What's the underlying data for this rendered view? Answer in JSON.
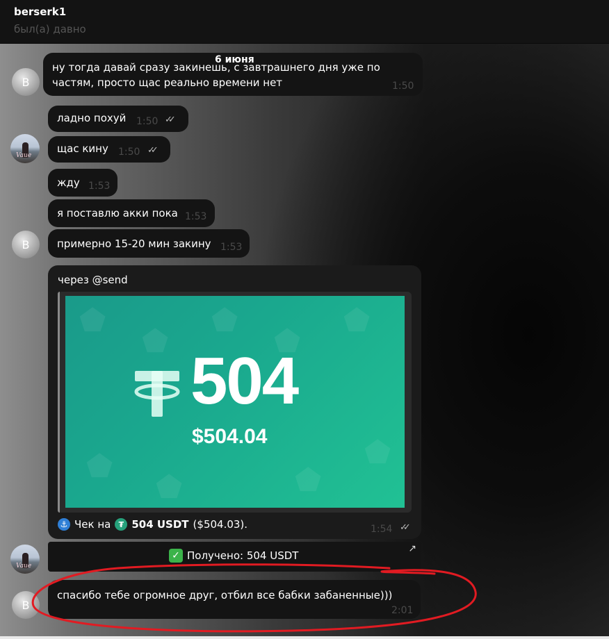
{
  "header": {
    "name": "berserk1",
    "status": "был(а) давно"
  },
  "date_label": "6 июня",
  "messages": [
    {
      "text": "ну тогда давай сразу закинешь, с завтрашнего дня уже по",
      "text2": "частям, просто щас реально времени нет",
      "time": "1:50"
    },
    {
      "text": "ладно похуй",
      "time": "1:50"
    },
    {
      "text": "щас кину",
      "time": "1:50"
    },
    {
      "text": "жду",
      "time": "1:53"
    },
    {
      "text": "я поставлю акки пока",
      "time": "1:53"
    },
    {
      "text": "примерно 15-20 мин закину",
      "time": "1:53"
    },
    {
      "text": "спасибо тебе огромное друг, отбил все бабки забаненные)))",
      "time": "2:01"
    }
  ],
  "avatar_letter": "B",
  "avatar_photo_text": "Vaue",
  "card": {
    "via": "через @send",
    "amount_big": "504",
    "amount_usd": "$504.04",
    "footer_prefix": "Чек на",
    "footer_amount": "504 USDT",
    "footer_usd": "($504.03).",
    "time": "1:54"
  },
  "received_text": "Получено: 504 USDT",
  "icons": {
    "ticks": "double-check-icon",
    "anchor": "anchor-icon",
    "tether": "tether-icon",
    "checkmark": "check-mark-icon",
    "arrow": "arrow-up-right-icon"
  },
  "colors": {
    "promo_start": "#1a9a8a",
    "promo_end": "#21c194",
    "annotation": "#e11b22"
  }
}
